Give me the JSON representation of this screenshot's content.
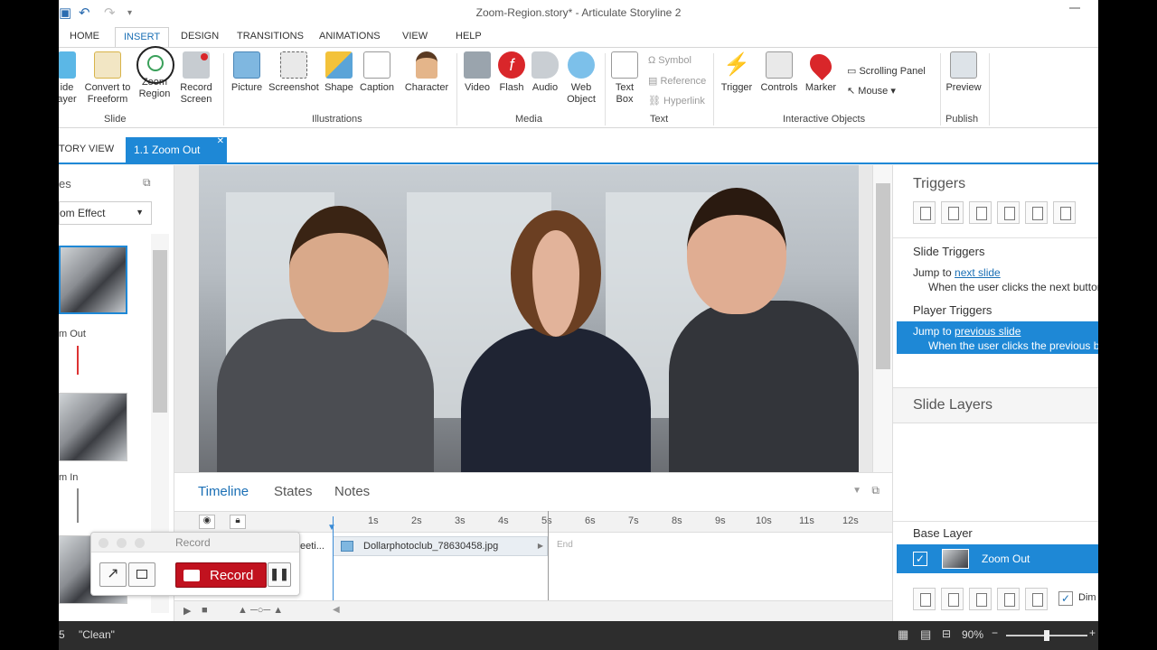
{
  "window": {
    "title": "Zoom-Region.story* - Articulate Storyline 2"
  },
  "ribbon_tabs": [
    "HOME",
    "INSERT",
    "DESIGN",
    "TRANSITIONS",
    "ANIMATIONS",
    "VIEW",
    "HELP"
  ],
  "ribbon": {
    "slide": {
      "label": "Slide",
      "btn1": "ide",
      "btn1b": "ayer",
      "convert": "Convert to",
      "convert2": "Freeform",
      "zoom": "Zoom",
      "zoom2": "Region",
      "record": "Record",
      "record2": "Screen"
    },
    "illustrations": {
      "label": "Illustrations",
      "picture": "Picture",
      "screenshot": "Screenshot",
      "shape": "Shape",
      "caption": "Caption",
      "character": "Character"
    },
    "media": {
      "label": "Media",
      "video": "Video",
      "flash": "Flash",
      "audio": "Audio",
      "web": "Web",
      "web2": "Object"
    },
    "text": {
      "label": "Text",
      "textbox": "Text",
      "textbox2": "Box",
      "symbol": "Symbol",
      "reference": "Reference",
      "hyperlink": "Hyperlink"
    },
    "interactive": {
      "label": "Interactive Objects",
      "trigger": "Trigger",
      "controls": "Controls",
      "marker": "Marker",
      "scrolling": "Scrolling Panel",
      "mouse": "Mouse"
    },
    "publish": {
      "label": "Publish",
      "preview": "Preview"
    }
  },
  "doc_tabs": {
    "story": "TORY VIEW",
    "active": "1.1 Zoom Out"
  },
  "left_panel": {
    "title": "es",
    "dropdown": "om Effect",
    "slides": [
      {
        "label": "m Out"
      },
      {
        "label": "m In"
      }
    ]
  },
  "timeline": {
    "tabs": [
      "Timeline",
      "States",
      "Notes"
    ],
    "ticks": [
      "1s",
      "2s",
      "3s",
      "4s",
      "5s",
      "6s",
      "7s",
      "8s",
      "9s",
      "10s",
      "11s",
      "12s"
    ],
    "row_label": "eeti...",
    "item": "Dollarphotoclub_78630458.jpg",
    "end": "End"
  },
  "triggers": {
    "title": "Triggers",
    "slide_triggers": "Slide Triggers",
    "t1_prefix": "Jump to ",
    "t1_link": "next slide",
    "t1_when": "When the user clicks the next button",
    "player_triggers": "Player Triggers",
    "t2_prefix": "Jump to ",
    "t2_link": "previous slide",
    "t2_when": "When the user clicks the previous button"
  },
  "layers": {
    "title": "Slide Layers",
    "base": "Base Layer",
    "layer_name": "Zoom Out",
    "dim": "Dim"
  },
  "record_widget": {
    "title": "Record",
    "button": "Record"
  },
  "status": {
    "num": "5",
    "theme": "\"Clean\"",
    "zoom": "90%"
  },
  "colors": {
    "accent": "#1e88d6",
    "record_red": "#c1121f",
    "flash_red": "#d9262a"
  }
}
